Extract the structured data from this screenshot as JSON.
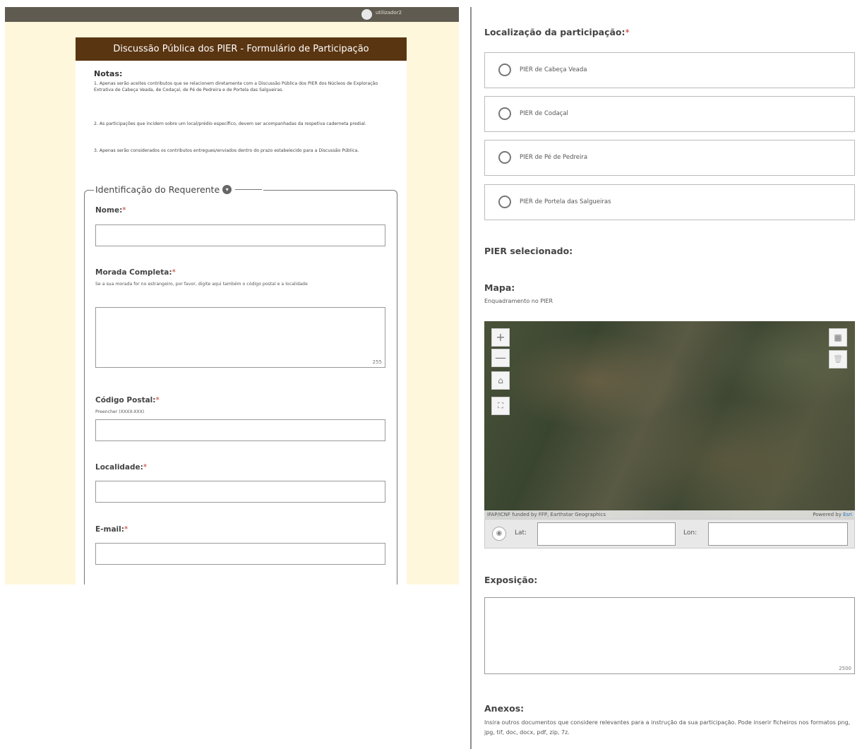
{
  "user": {
    "name": "utilizador2"
  },
  "form": {
    "header": "Discussão Pública dos PIER - Formulário de Participação",
    "notes_title": "Notas:",
    "notes": [
      "1. Apenas serão aceites contributos que se relacionem diretamente com a Discussão Pública dos PIER dos Núcleos de Exploração Extrativa de Cabeça Veada, de Codaçal, de Pé de Pedreira e de Portela das Salgueiras.",
      "2. As participações que incidem sobre um local/prédio específico, devem ser acompanhadas da respetiva caderneta predial.",
      "3. Apenas serão considerados os contributos entregues/enviados dentro do prazo estabelecido para a Discussão Pública."
    ],
    "section_title": "Identificação do Requerente",
    "section_toggle_icon": "chevron-down-icon",
    "fields": {
      "nome": {
        "label": "Nome:",
        "required": "*",
        "value": ""
      },
      "morada": {
        "label": "Morada Completa:",
        "required": "*",
        "help": "Se a sua morada for no estrangeiro, por favor, digite aqui também o código postal e a localidade",
        "value": "",
        "counter": "255"
      },
      "codigo_postal": {
        "label": "Código Postal:",
        "required": "*",
        "help": "Preencher (XXXX-XXX)",
        "value": ""
      },
      "localidade": {
        "label": "Localidade:",
        "required": "*",
        "value": ""
      },
      "email": {
        "label": "E-mail:",
        "required": "*",
        "value": ""
      }
    }
  },
  "participation": {
    "location_label": "Localização da participação:",
    "required": "*",
    "options": [
      "PIER de Cabeça Veada",
      "PIER de Codaçal",
      "PIER de Pé de Pedreira",
      "PIER de Portela das Salgueiras"
    ],
    "selected_label": "PIER selecionado:",
    "map_label": "Mapa:",
    "map_help": "Enquadramento no PIER",
    "map_controls": [
      "+",
      "—"
    ],
    "attribution": "IFAP/ICNF funded by FFP, Earthstar Geographics",
    "powered_by": "Powered by ",
    "esri": "Esri",
    "lat_label": "Lat:",
    "lon_label": "Lon:",
    "exposicao_label": "Exposição:",
    "exposicao_counter": "2500",
    "anexos_label": "Anexos:",
    "anexos_help": "Insira outros documentos que considere relevantes para a instrução da sua participação. Pode inserir ficheiros nos formatos png, jpg, tif, doc, docx, pdf, zip, 7z."
  }
}
